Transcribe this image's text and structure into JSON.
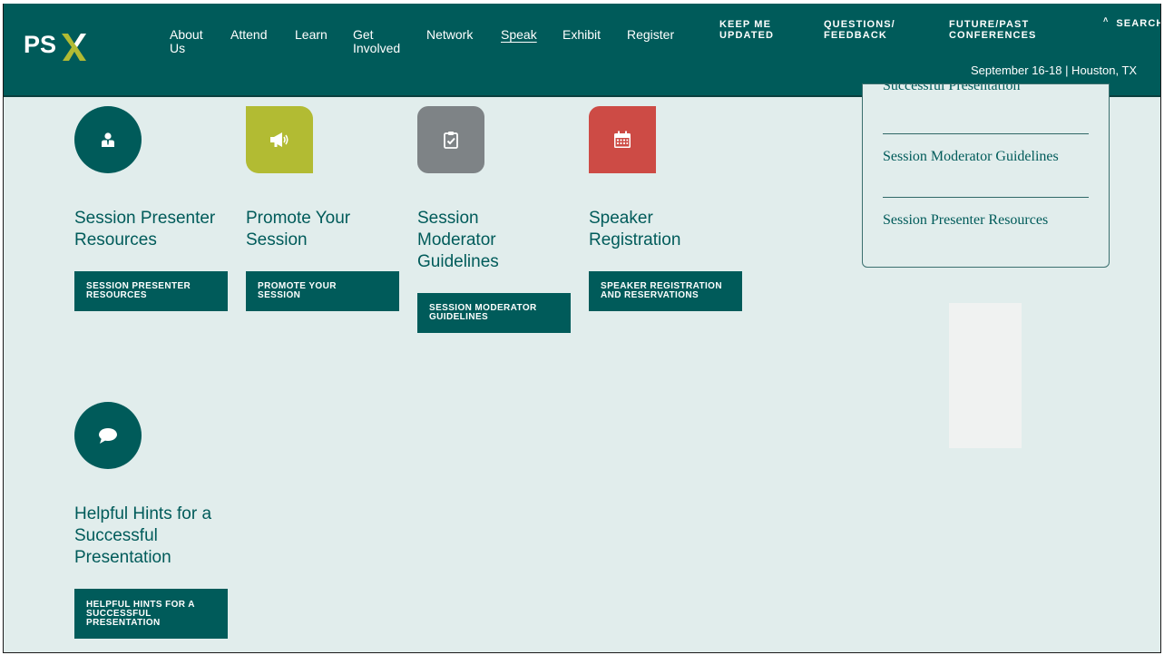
{
  "brand": {
    "logo_text": "PSX",
    "primary_color": "#005b5a",
    "accent_color": "#b2bb33"
  },
  "nav": {
    "items": [
      {
        "label_line1": "About",
        "label_line2": "Us"
      },
      {
        "label_line1": "Attend"
      },
      {
        "label_line1": "Learn"
      },
      {
        "label_line1": "Get",
        "label_line2": "Involved"
      },
      {
        "label_line1": "Network"
      },
      {
        "label_line1": "Speak",
        "active": true
      },
      {
        "label_line1": "Exhibit"
      },
      {
        "label_line1": "Register"
      }
    ]
  },
  "utility": {
    "keep_updated_line1": "KEEP ME",
    "keep_updated_line2": "UPDATED",
    "questions_line1": "QUESTIONS/",
    "questions_line2": "FEEDBACK",
    "future_line1": "FUTURE/PAST",
    "future_line2": "CONFERENCES",
    "search_label": "SEARCH"
  },
  "event": {
    "date_location": "September 16-18 | Houston, TX"
  },
  "cards": [
    {
      "icon": "presenter-icon",
      "tile": "circle",
      "title": "Session Presenter Resources",
      "cta_line1": "SESSION PRESENTER",
      "cta_line2": "RESOURCES"
    },
    {
      "icon": "megaphone-icon",
      "tile": "green",
      "title": "Promote Your Session",
      "cta_line1": "PROMOTE YOUR",
      "cta_line2": "SESSION"
    },
    {
      "icon": "clipboard-check-icon",
      "tile": "gray",
      "title": "Session Moderator Guidelines",
      "cta_line1": "SESSION MODERATOR",
      "cta_line2": "GUIDELINES"
    },
    {
      "icon": "calendar-icon",
      "tile": "red",
      "title": "Speaker Registration",
      "cta_line1": "SPEAKER REGISTRATION",
      "cta_line2": "AND RESERVATIONS"
    },
    {
      "icon": "chat-bubble-icon",
      "tile": "circle",
      "title": "Helpful Hints for a Successful Presentation",
      "cta_line1": "HELPFUL HINTS FOR A",
      "cta_line2": "SUCCESSFUL",
      "cta_line3": "PRESENTATION"
    }
  ],
  "sidebar": {
    "links": [
      {
        "label": "Successful Presentation"
      },
      {
        "label": "Session Moderator Guidelines"
      },
      {
        "label": "Session Presenter Resources"
      }
    ]
  }
}
